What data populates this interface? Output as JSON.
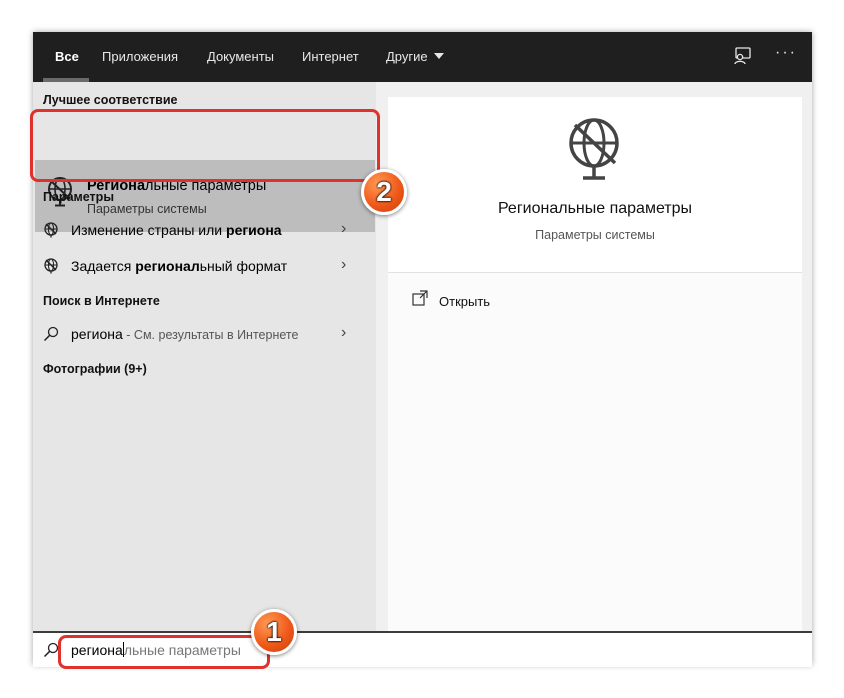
{
  "tabs": [
    {
      "label": "Все",
      "active": true
    },
    {
      "label": "Приложения"
    },
    {
      "label": "Документы"
    },
    {
      "label": "Интернет"
    },
    {
      "label": "Другие"
    }
  ],
  "more_label": "···",
  "left": {
    "best_match_heading": "Лучшее соответствие",
    "best_match": {
      "title_bold": "Региона",
      "title_rest": "льные параметры",
      "subtitle": "Параметры системы",
      "icon": "globe-settings-icon"
    },
    "settings_heading": "Параметры",
    "settings_items": [
      {
        "pre": "Изменение страны или ",
        "bold": "региона",
        "post": ""
      },
      {
        "pre": "Задается ",
        "bold": "регионал",
        "post": "ьный формат"
      }
    ],
    "web_heading": "Поиск в Интернете",
    "web_item": {
      "query": "региона",
      "suffix": " - См. результаты в Интернете"
    },
    "photos_heading": "Фотографии (9+)"
  },
  "right": {
    "title": "Региональные параметры",
    "subtitle": "Параметры системы",
    "open_label": "Открыть"
  },
  "search": {
    "typed": "региона",
    "autocomplete": "льные параметры"
  },
  "annotations": {
    "step1": "1",
    "step2": "2",
    "color": "#e0322d"
  }
}
